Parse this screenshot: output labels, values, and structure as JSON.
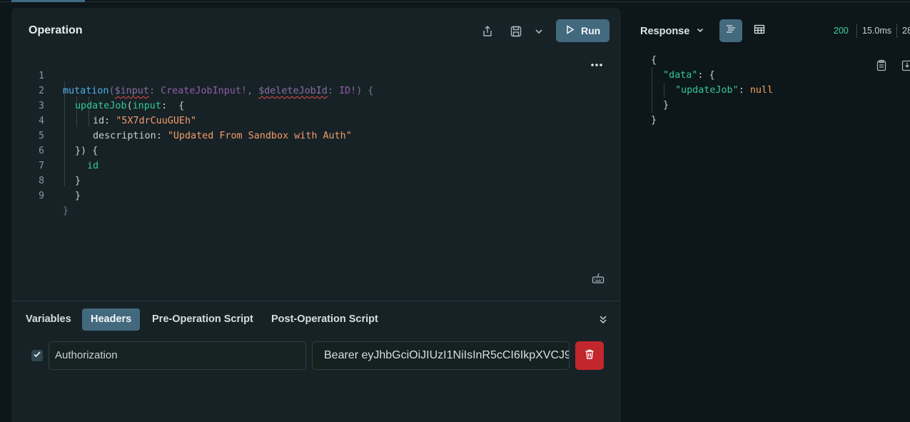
{
  "operation": {
    "title": "Operation",
    "run_label": "Run",
    "line_numbers": [
      "1",
      "2",
      "3",
      "4",
      "5",
      "6",
      "7",
      "8",
      "9"
    ],
    "code": {
      "l1_kw": "mutation",
      "l1_open": "(",
      "l1_var1": "$input",
      "l1_colon1": ": ",
      "l1_type1": "CreateJobInput!",
      "l1_comma": ", ",
      "l1_var2": "$deleteJobId",
      "l1_colon2": ": ",
      "l1_type2": "ID!",
      "l1_close": ") {",
      "l2_field": "updateJob",
      "l2_open": "(",
      "l2_arg": "input",
      "l2_rest": ":  {",
      "l3_key": "id",
      "l3_colon": ": ",
      "l3_val": "\"5X7drCuuGUEh\"",
      "l4_key": "description",
      "l4_colon": ": ",
      "l4_val": "\"Updated From Sandbox with Auth\"",
      "l5": "}) {",
      "l6_field": "id",
      "l7": "}",
      "l8": "}",
      "l9": "}"
    }
  },
  "bottom_tabs": [
    "Variables",
    "Headers",
    "Pre-Operation Script",
    "Post-Operation Script"
  ],
  "active_tab": "Headers",
  "headers": [
    {
      "key": "Authorization",
      "value": "Bearer eyJhbGciOiJIUzI1NiIsInR5cCI6IkpXVCJ9",
      "enabled": true
    }
  ],
  "response": {
    "title": "Response",
    "status": "200",
    "time": "15.0ms",
    "size": "28",
    "status_color": "#3fd39b",
    "json": {
      "open": "{",
      "data_key": "\"data\"",
      "data_rest": ": {",
      "update_key": "\"updateJob\"",
      "update_colon": ": ",
      "update_val": "null",
      "inner_close": "}",
      "outer_close": "}"
    }
  },
  "icons": {
    "share": "share-icon",
    "save": "save-icon",
    "chevron": "chevron-down-icon",
    "play": "play-icon",
    "more": "more-icon",
    "keyboard": "keyboard-icon",
    "collapse": "collapse-icon",
    "check": "check-icon",
    "trash": "trash-icon",
    "copy": "clipboard-icon",
    "download": "download-icon",
    "text_view": "text-view-icon",
    "table_view": "table-view-icon"
  }
}
